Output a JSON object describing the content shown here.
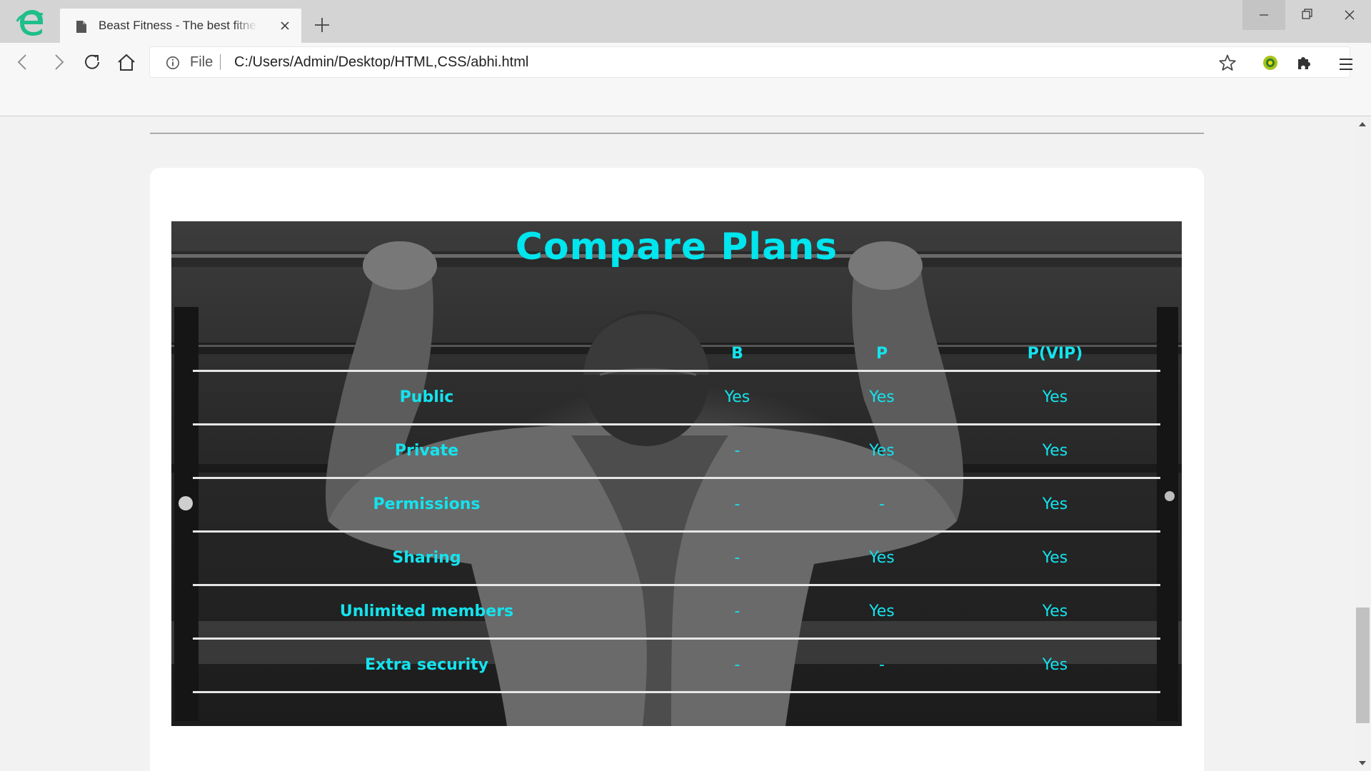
{
  "browser": {
    "tab_title": "Beast Fitness - The best fitness",
    "address_scheme_label": "File",
    "address_url": "C:/Users/Admin/Desktop/HTML,CSS/abhi.html"
  },
  "icons": {
    "app_logo": "edge-like-logo-icon",
    "tab_page": "document-icon",
    "tab_close": "close-icon",
    "new_tab": "plus-icon",
    "back": "chevron-left-icon",
    "forward": "chevron-right-icon",
    "reload": "reload-icon",
    "home": "home-icon",
    "site_info": "info-icon",
    "bookmark": "star-icon",
    "extension": "extension-icon",
    "extensions_menu": "puzzle-icon",
    "main_menu": "hamburger-icon"
  },
  "colors": {
    "accent_cyan": "#14e3ee",
    "title_cyan": "#00e5ee",
    "row_divider": "#e6e6e6",
    "logo_green": "#1fbe8a"
  },
  "compare_plans": {
    "title": "Compare Plans",
    "headers": [
      "",
      "B",
      "P",
      "P(VIP)"
    ],
    "rows": [
      {
        "feature": "Public",
        "b": "Yes",
        "p": "Yes",
        "vip": "Yes"
      },
      {
        "feature": "Private",
        "b": "-",
        "p": "Yes",
        "vip": "Yes"
      },
      {
        "feature": "Permissions",
        "b": "-",
        "p": "-",
        "vip": "Yes"
      },
      {
        "feature": "Sharing",
        "b": "-",
        "p": "Yes",
        "vip": "Yes"
      },
      {
        "feature": "Unlimited members",
        "b": "-",
        "p": "Yes",
        "vip": "Yes"
      },
      {
        "feature": "Extra security",
        "b": "-",
        "p": "-",
        "vip": "Yes"
      }
    ]
  }
}
